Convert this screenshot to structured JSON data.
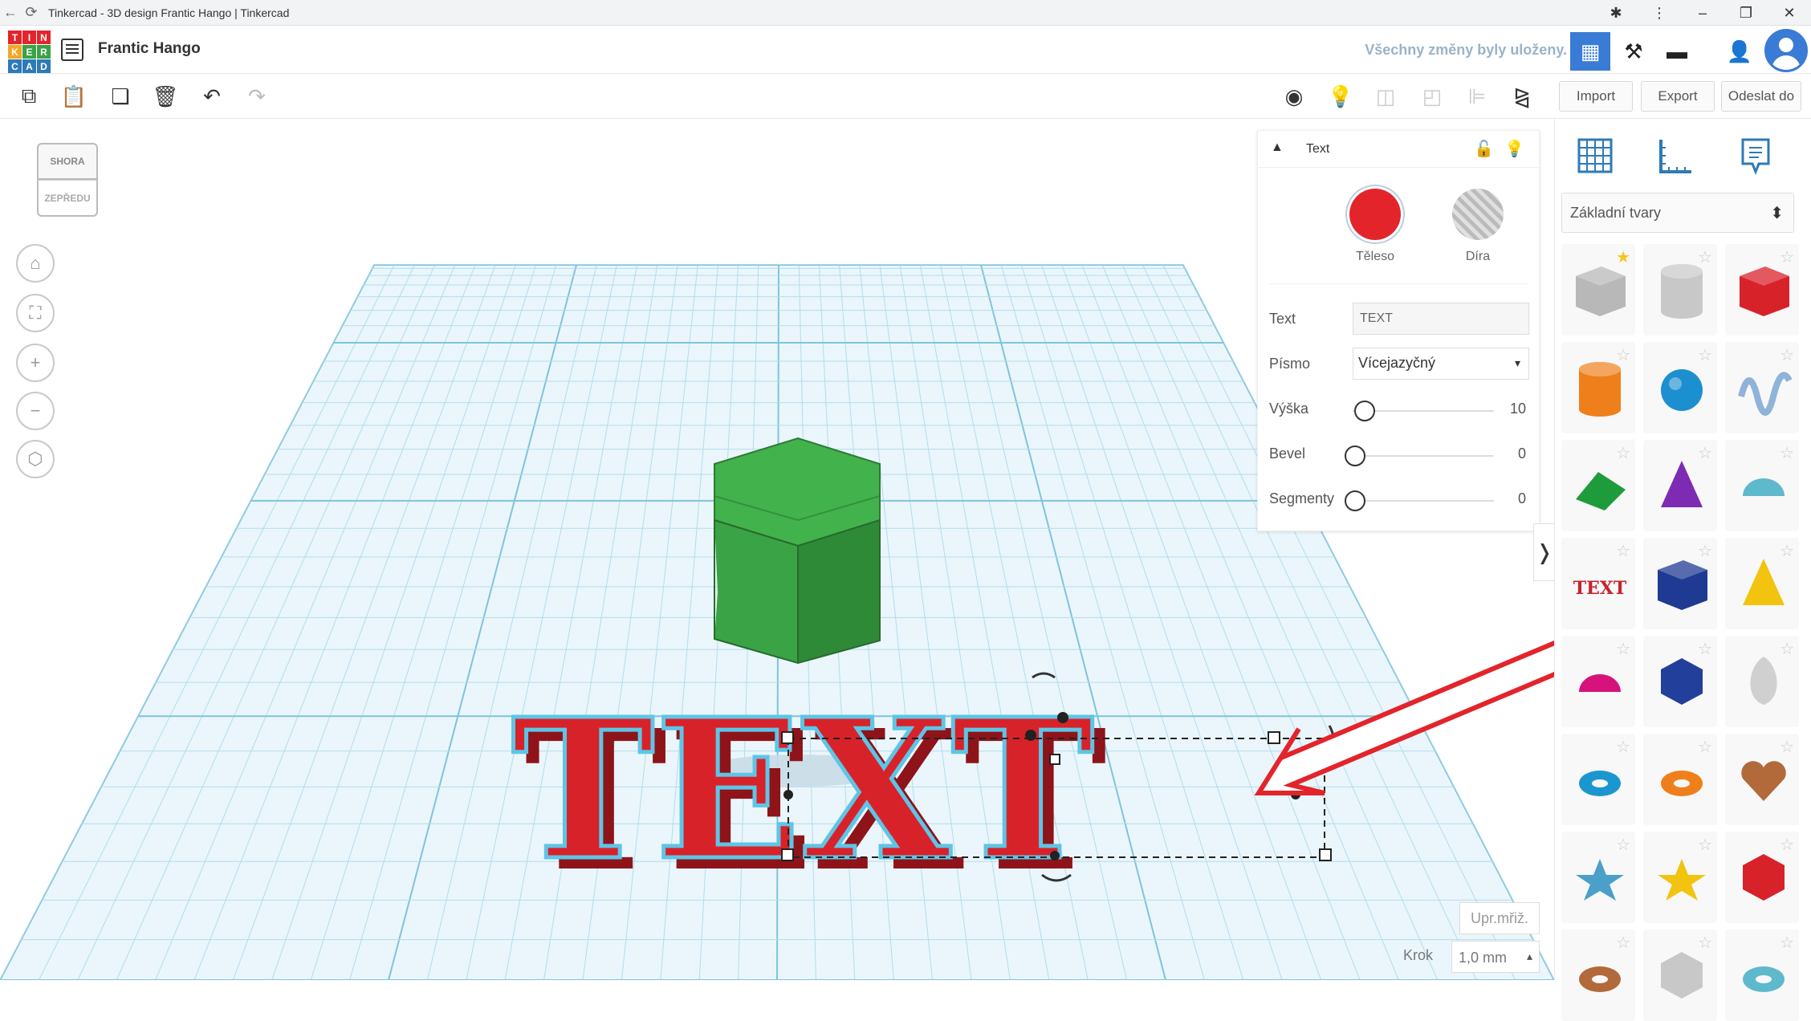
{
  "browser": {
    "tab_title": "Tinkercad - 3D design Frantic Hango | Tinkercad"
  },
  "logo_letters": [
    "T",
    "I",
    "N",
    "K",
    "E",
    "R",
    "C",
    "A",
    "D"
  ],
  "header": {
    "project_name": "Frantic Hango",
    "save_status": "Všechny změny byly uloženy."
  },
  "toolbar": {
    "actions": {
      "import": "Import",
      "export": "Export",
      "send_to": "Odeslat do"
    }
  },
  "viewcube": {
    "top": "SHORA",
    "front": "ZEPŘEDU"
  },
  "inspector": {
    "title": "Text",
    "solid_label": "Těleso",
    "hole_label": "Díra",
    "solid_color": "#e3242b",
    "props": {
      "text_label": "Text",
      "text_value": "TEXT",
      "font_label": "Písmo",
      "font_value": "Vícejazyčný",
      "height_label": "Výška",
      "height_value": "10",
      "bevel_label": "Bevel",
      "bevel_value": "0",
      "segments_label": "Segmenty",
      "segments_value": "0"
    }
  },
  "workplane": {
    "grid_settings": "Upr.mřiž.",
    "snap_label": "Krok",
    "snap_value": "1,0 mm",
    "model_text": "TEXT"
  },
  "shapes_panel": {
    "library": "Základní tvary",
    "shapes": [
      {
        "name": "box-striped",
        "color": "#b8b8b8",
        "favorite": true
      },
      {
        "name": "cylinder-striped",
        "color": "#c8c8c8",
        "favorite": false
      },
      {
        "name": "box",
        "color": "#d8222a",
        "favorite": false
      },
      {
        "name": "cylinder",
        "color": "#ef7f1a",
        "favorite": false
      },
      {
        "name": "sphere",
        "color": "#1c8fd0",
        "favorite": false
      },
      {
        "name": "scribble",
        "color": "#8fb3d9",
        "favorite": false
      },
      {
        "name": "roof",
        "color": "#1e9b3b",
        "favorite": false
      },
      {
        "name": "cone",
        "color": "#7d2bb3",
        "favorite": false
      },
      {
        "name": "round-roof",
        "color": "#5fb9cc",
        "favorite": false
      },
      {
        "name": "text",
        "color": "#c8222a",
        "favorite": false
      },
      {
        "name": "wedge",
        "color": "#1f3a93",
        "favorite": false
      },
      {
        "name": "pyramid",
        "color": "#f2c40f",
        "favorite": false
      },
      {
        "name": "half-sphere",
        "color": "#d6127d",
        "favorite": false
      },
      {
        "name": "polygon",
        "color": "#233f9c",
        "favorite": false
      },
      {
        "name": "paraboloid",
        "color": "#d0d0d0",
        "favorite": false
      },
      {
        "name": "torus",
        "color": "#1c96cf",
        "favorite": false
      },
      {
        "name": "tube",
        "color": "#ef7f1a",
        "favorite": false
      },
      {
        "name": "heart",
        "color": "#b26a3a",
        "favorite": false
      },
      {
        "name": "star",
        "color": "#4aa0c8",
        "favorite": false
      },
      {
        "name": "star-gold",
        "color": "#f2c40f",
        "favorite": false
      },
      {
        "name": "icosahedron",
        "color": "#d8222a",
        "favorite": false
      },
      {
        "name": "ring",
        "color": "#b26a3a",
        "favorite": false
      },
      {
        "name": "polyhedron",
        "color": "#c8c8c8",
        "favorite": false
      },
      {
        "name": "ellipsoid",
        "color": "#5fb9cc",
        "favorite": false
      }
    ]
  },
  "colors": {
    "accent": "#3a7bd5",
    "grid": "#bfe3f0",
    "hexagon": "#3aa345",
    "text_model": "#d8222a",
    "arrow": "#e3242b"
  }
}
